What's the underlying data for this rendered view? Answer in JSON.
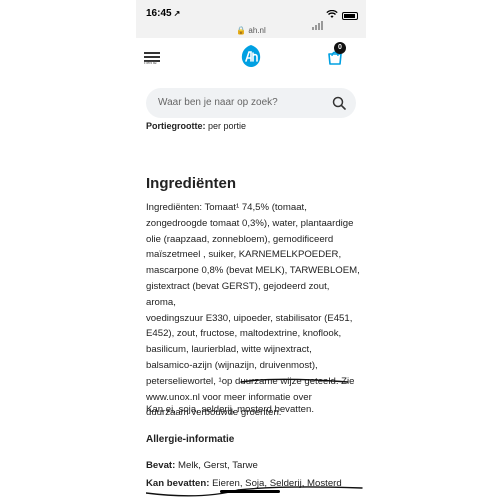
{
  "status_bar": {
    "time": "16:45",
    "location_arrow": "↗",
    "url": "ah.nl"
  },
  "nav": {
    "menu_label": "menu",
    "cart_count": "0"
  },
  "search": {
    "placeholder": "Waar ben je naar op zoek?"
  },
  "portion": {
    "label": "Portiegrootte:",
    "value": "per portie"
  },
  "ingredients": {
    "heading": "Ingrediënten",
    "lines": [
      "Ingrediënten: Tomaat¹ 74,5% (tomaat,",
      "zongedroogde tomaat 0,3%), water, plantaardige",
      "olie (raapzaad, zonnebloem), gemodificeerd",
      "maïszetmeel , suiker, KARNEMELKPOEDER,",
      "mascarpone 0,8% (bevat MELK), TARWEBLOEM,",
      "gistextract (bevat GERST), gejodeerd zout, aroma,",
      "voedingszuur E330, uipoeder, stabilisator (E451,",
      "E452), zout, fructose, maltodextrine, knoflook,",
      "basilicum, laurierblad, witte wijnextract,",
      "balsamico-azijn (wijnazijn, druivenmost),",
      "peterseliewortel, ¹op duurzame wijze geteeld. Zie",
      "www.unox.nl voor meer informatie over",
      "duurzaam verbouwde groenten."
    ]
  },
  "allergen_note": "Kan ei, soja, selderij, mosterd bevatten.",
  "allergy": {
    "heading": "Allergie-informatie",
    "contains_label": "Bevat:",
    "contains_value": "Melk, Gerst, Tarwe",
    "may_contain_label": "Kan bevatten:",
    "may_contain_value": "Eieren, Soja, Selderij, Mosterd"
  },
  "colors": {
    "brand": "#00a0e2",
    "text": "#222222",
    "search_bg": "#f0f2f4",
    "status_bg": "#f2f2f2"
  },
  "icons": [
    "menu-icon",
    "ah-logo-icon",
    "cart-icon",
    "search-icon",
    "wifi-icon",
    "battery-icon"
  ]
}
